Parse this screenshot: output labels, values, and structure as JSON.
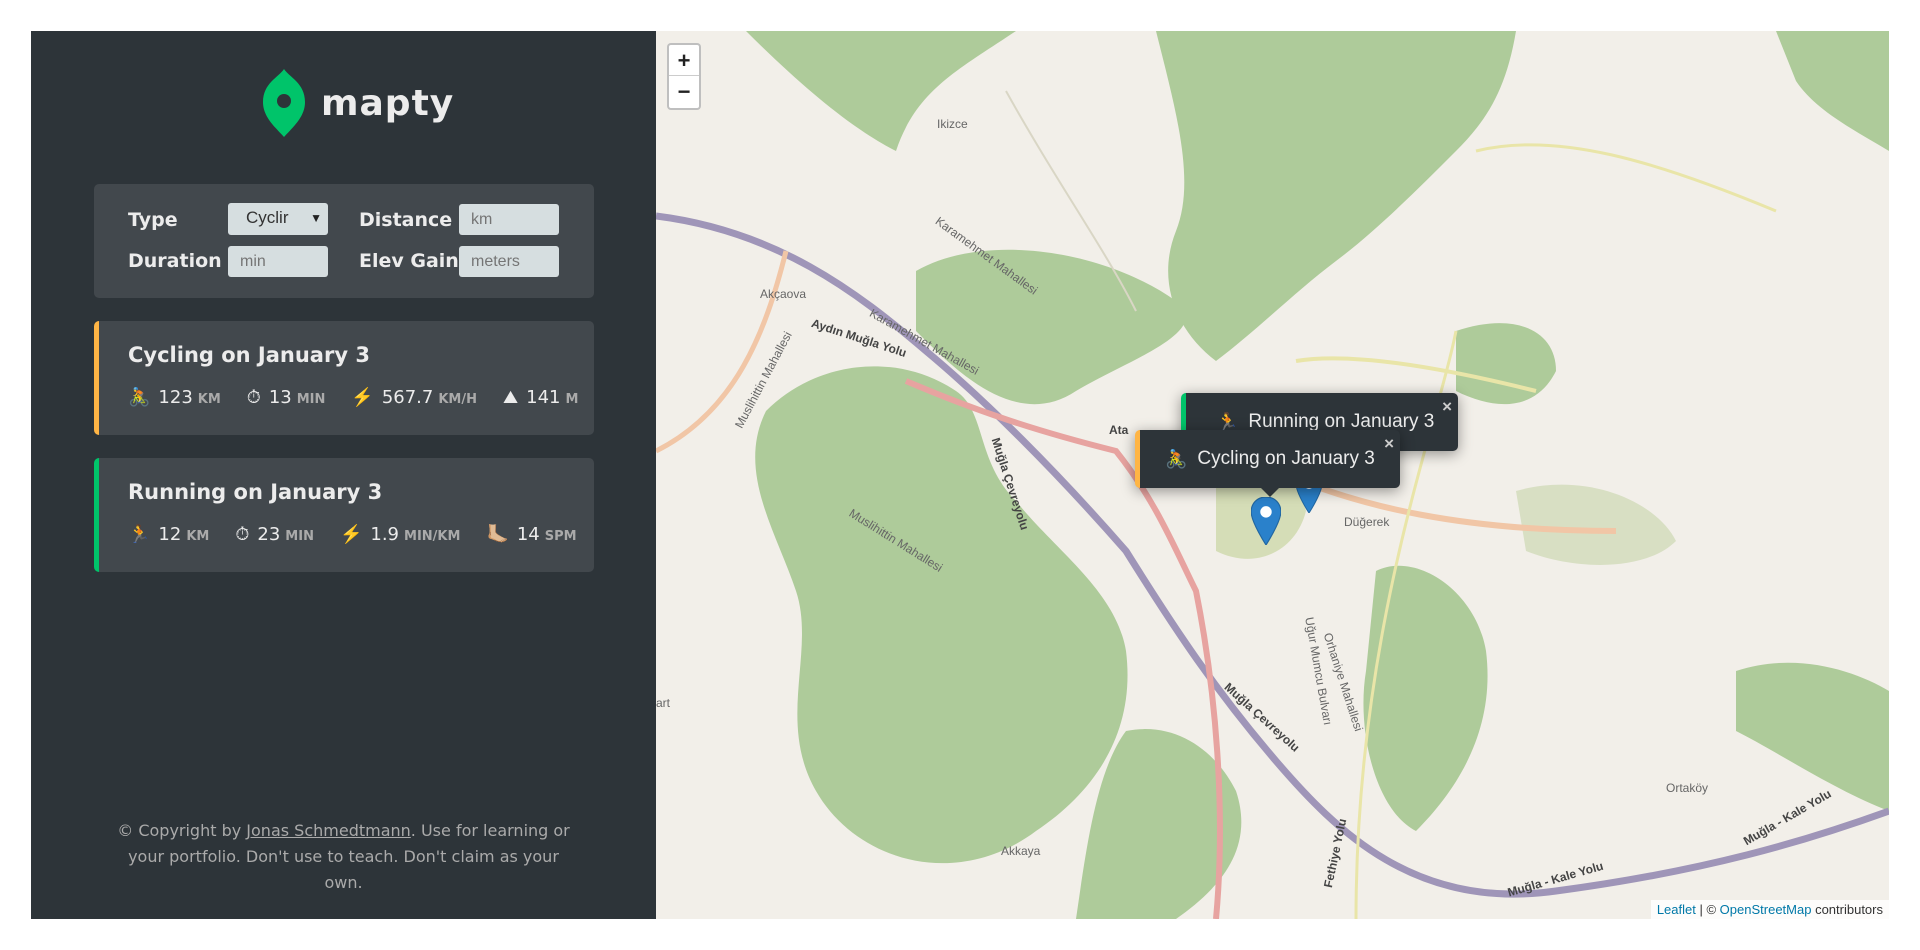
{
  "app": {
    "logo_text": "mapty"
  },
  "form": {
    "type_label": "Type",
    "type_value": "Cyclir",
    "distance_label": "Distance",
    "distance_placeholder": "km",
    "duration_label": "Duration",
    "duration_placeholder": "min",
    "elev_label": "Elev Gain",
    "elev_placeholder": "meters"
  },
  "workouts": [
    {
      "title": "Cycling on January 3",
      "type": "cycling",
      "details": [
        {
          "icon": "🚴",
          "value": "123",
          "unit": "KM"
        },
        {
          "icon": "⏱",
          "value": "13",
          "unit": "MIN"
        },
        {
          "icon": "⚡️",
          "value": "567.7",
          "unit": "KM/H"
        },
        {
          "icon": "⛰",
          "value": "141",
          "unit": "M"
        }
      ]
    },
    {
      "title": "Running on January 3",
      "type": "running",
      "details": [
        {
          "icon": "🏃",
          "value": "12",
          "unit": "KM"
        },
        {
          "icon": "⏱",
          "value": "23",
          "unit": "MIN"
        },
        {
          "icon": "⚡️",
          "value": "1.9",
          "unit": "MIN/KM"
        },
        {
          "icon": "🦶🏼",
          "value": "14",
          "unit": "SPM"
        }
      ]
    }
  ],
  "copyright": {
    "prefix": "© Copyright by ",
    "author": "Jonas Schmedtmann",
    "suffix": ". Use for learning or your portfolio. Don't use to teach. Don't claim as your own."
  },
  "map": {
    "zoom_in": "+",
    "zoom_out": "−",
    "popups": [
      {
        "icon": "🏃",
        "text": "Running on January 3",
        "close": "×"
      },
      {
        "icon": "🚴",
        "text": "Cycling on January 3",
        "close": "×"
      }
    ],
    "labels": {
      "ikizce": "Ikizce",
      "akcaova": "Akçaova",
      "aydin": "Aydın Muğla Yolu",
      "karamehmet1": "Karamehmet Mahallesi",
      "karamehmet2": "Karamehmet Mahallesi",
      "muslihittin1": "Muslihittin Mahallesi",
      "muslihittin2": "Muslihittin Mahallesi",
      "cevreyolu1": "Muğla Çevreyolu",
      "cevreyolu2": "Muğla Çevreyolu",
      "dugerek": "Düğerek",
      "orhaniye": "Orhaniye Mahallesi",
      "ugur": "Uğur Mumcu Bulvarı",
      "ortakoy": "Ortaköy",
      "akkaya": "Akkaya",
      "kale1": "Muğla - Kale Yolu",
      "kale2": "Muğla - Kale Yolu",
      "fethiye": "Fethiye Yolu",
      "ata": "Ata",
      "art": "art"
    },
    "attribution": {
      "leaflet": "Leaflet",
      "sep": " | © ",
      "osm": "OpenStreetMap",
      "contributors": " contributors"
    }
  },
  "colors": {
    "sidebar_bg": "#2d3439",
    "panel_bg": "#42484d",
    "brand_green": "#00c46a",
    "brand_orange": "#ffb545"
  }
}
